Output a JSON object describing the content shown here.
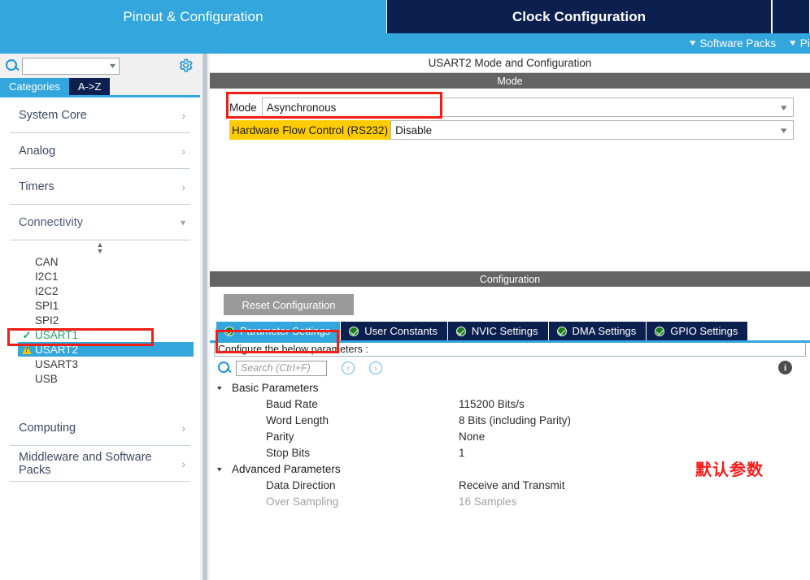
{
  "topbar": {
    "tabs": [
      {
        "label": "Pinout & Configuration",
        "state": "active"
      },
      {
        "label": "Clock Configuration",
        "state": "inactive-dark"
      },
      {
        "label": "",
        "state": "inactive-dark"
      }
    ]
  },
  "subbar": {
    "items": [
      {
        "label": "Software Packs",
        "icon": "chevron-down-icon"
      },
      {
        "label": "Pinout",
        "icon": "chevron-down-icon"
      }
    ]
  },
  "sidebar": {
    "search": {
      "value": "",
      "placeholder": ""
    },
    "gear_icon": "gear-icon",
    "search_icon": "search-icon",
    "tabs": [
      {
        "label": "Categories",
        "selected": true
      },
      {
        "label": "A->Z",
        "selected": false
      }
    ],
    "categories": [
      {
        "label": "System Core",
        "expanded": false,
        "arrow": "chevron-right-icon"
      },
      {
        "label": "Analog",
        "expanded": false,
        "arrow": "chevron-right-icon"
      },
      {
        "label": "Timers",
        "expanded": false,
        "arrow": "chevron-right-icon"
      },
      {
        "label": "Connectivity",
        "expanded": true,
        "arrow": "chevron-down-icon"
      }
    ],
    "peripherals": [
      {
        "label": "CAN",
        "status": "none"
      },
      {
        "label": "I2C1",
        "status": "none"
      },
      {
        "label": "I2C2",
        "status": "none"
      },
      {
        "label": "SPI1",
        "status": "none"
      },
      {
        "label": "SPI2",
        "status": "none"
      },
      {
        "label": "USART1",
        "status": "ok",
        "icon": "check-icon"
      },
      {
        "label": "USART2",
        "status": "warning",
        "icon": "warning-triangle-icon",
        "selected": true
      },
      {
        "label": "USART3",
        "status": "none"
      },
      {
        "label": "USB",
        "status": "none"
      }
    ],
    "categories_bottom": [
      {
        "label": "Computing",
        "expanded": false,
        "arrow": "chevron-right-icon"
      },
      {
        "label": "Middleware and Software Packs",
        "expanded": false,
        "arrow": "chevron-right-icon"
      }
    ]
  },
  "main": {
    "panel_title": "USART2 Mode and Configuration",
    "mode_section": {
      "header": "Mode",
      "fields": [
        {
          "label": "Mode",
          "value": "Asynchronous",
          "highlight": false
        },
        {
          "label": "Hardware Flow Control (RS232)",
          "value": "Disable",
          "highlight": true
        }
      ]
    },
    "config_section": {
      "header": "Configuration",
      "reset_button": "Reset Configuration",
      "tabs": [
        {
          "label": "Parameter Settings",
          "active": true,
          "icon": "check-circle-icon"
        },
        {
          "label": "User Constants",
          "active": false,
          "icon": "check-circle-icon"
        },
        {
          "label": "NVIC Settings",
          "active": false,
          "icon": "check-circle-icon"
        },
        {
          "label": "DMA Settings",
          "active": false,
          "icon": "check-circle-icon"
        },
        {
          "label": "GPIO Settings",
          "active": false,
          "icon": "check-circle-icon"
        }
      ],
      "note": "Configure the below parameters :",
      "find": {
        "placeholder": "Search (Ctrl+F)",
        "value": "",
        "search_icon": "search-icon",
        "prev_label": "‹",
        "next_label": "›",
        "info_label": "i"
      },
      "groups": [
        {
          "label": "Basic Parameters",
          "expanded": true,
          "rows": [
            {
              "name": "Baud Rate",
              "value": "115200 Bits/s",
              "disabled": false
            },
            {
              "name": "Word Length",
              "value": "8 Bits (including Parity)",
              "disabled": false
            },
            {
              "name": "Parity",
              "value": "None",
              "disabled": false
            },
            {
              "name": "Stop Bits",
              "value": "1",
              "disabled": false
            }
          ]
        },
        {
          "label": "Advanced Parameters",
          "expanded": true,
          "rows": [
            {
              "name": "Data Direction",
              "value": "Receive and Transmit",
              "disabled": false
            },
            {
              "name": "Over Sampling",
              "value": "16 Samples",
              "disabled": true
            }
          ]
        }
      ]
    }
  },
  "annotations": {
    "note_text": "默认参数",
    "color": "#ff1a1a",
    "boxes": [
      {
        "name": "usart2-highlight"
      },
      {
        "name": "mode-field-highlight"
      },
      {
        "name": "parameter-settings-tab-highlight"
      }
    ]
  }
}
